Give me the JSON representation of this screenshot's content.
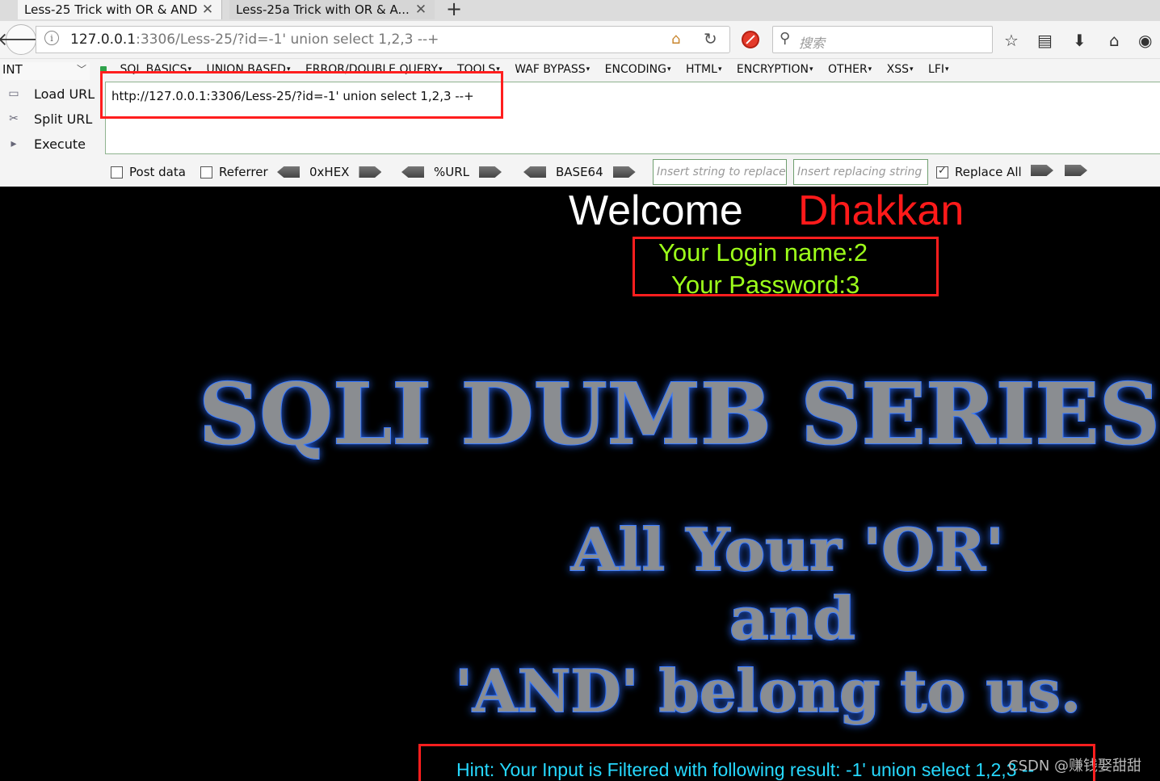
{
  "tabs": [
    {
      "label": "Less-25 Trick with OR & AND",
      "active": true
    },
    {
      "label": "Less-25a Trick with OR & A...",
      "active": false
    }
  ],
  "nav": {
    "url_host": "127.0.0.1",
    "url_path": ":3306/Less-25/?id=-1' union select 1,2,3 --+",
    "search_placeholder": "搜索"
  },
  "hackbar": {
    "mode": "INT",
    "menu": [
      "SQL BASICS",
      "UNION BASED",
      "ERROR/DOUBLE QUERY",
      "TOOLS",
      "WAF BYPASS",
      "ENCODING",
      "HTML",
      "ENCRYPTION",
      "OTHER",
      "XSS",
      "LFI"
    ],
    "load_url": "Load URL",
    "split_url": "Split URL",
    "execute": "Execute",
    "url_value": "http://127.0.0.1:3306/Less-25/?id=-1' union select 1,2,3 --+",
    "post_data": "Post data",
    "referrer": "Referrer",
    "enc_hex": "0xHEX",
    "enc_url": "%URL",
    "enc_b64": "BASE64",
    "replace_placeholder": "Insert string to replace",
    "replacing_placeholder": "Insert replacing string",
    "replace_all": "Replace All",
    "replace_all_checked": true
  },
  "page": {
    "welcome": "Welcome",
    "name": "Dhakkan",
    "login_line": "Your Login name:2",
    "password_line": "Your Password:3",
    "banner_title": "SQLI DUMB SERIES",
    "banner_line1": "All Your 'OR'",
    "banner_line2": "and",
    "banner_line3": "'AND' belong to us.",
    "hint": "Hint: Your Input is Filtered with following result: -1' union select 1,2,3 --",
    "watermark": "CSDN @赚钱娶甜甜"
  },
  "colors": {
    "welcome": "#ffffff",
    "name": "#ff1a1a",
    "credentials": "#9dff1a",
    "hint": "#26d9ff",
    "annotation": "#ff1e1e"
  }
}
